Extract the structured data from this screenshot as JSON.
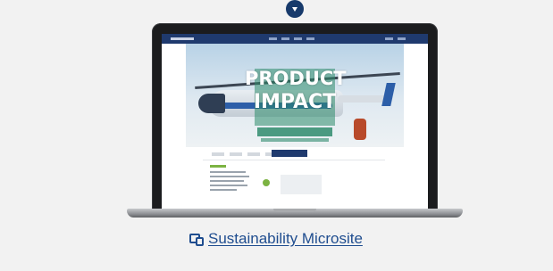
{
  "toggle": {
    "icon": "caret-down-icon"
  },
  "preview": {
    "hero_title_line1": "PRODUCT",
    "hero_title_line2": "IMPACT"
  },
  "link": {
    "icon": "devices-icon",
    "label": "Sustainability Microsite"
  },
  "colors": {
    "background": "#f2f2f2",
    "accent": "#173a6b",
    "link": "#1f4d8f"
  }
}
